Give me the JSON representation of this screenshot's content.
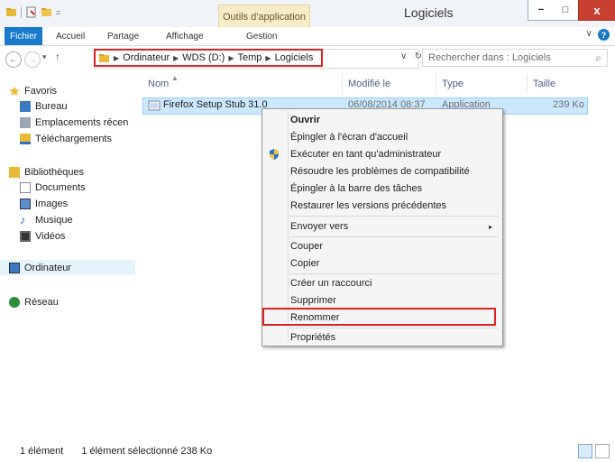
{
  "window": {
    "title": "Logiciels",
    "context_tab": "Outils d'application",
    "min_label": "−",
    "max_label": "□",
    "close_label": "x"
  },
  "ribbon": {
    "tabs": [
      "Fichier",
      "Accueil",
      "Partage",
      "Affichage",
      "Gestion"
    ],
    "chevron": "∨",
    "help": "?"
  },
  "address": {
    "back": "←",
    "forward": "→",
    "up": "↑",
    "recent": "▾",
    "crumbs": [
      "Ordinateur",
      "WDS (D:)",
      "Temp",
      "Logiciels"
    ],
    "dropdown": "∨",
    "refresh": "↻",
    "search_placeholder": "Rechercher dans : Logiciels",
    "search_icon": "⌕"
  },
  "nav": {
    "favoris": "Favoris",
    "fav_items": [
      "Bureau",
      "Emplacements récen",
      "Téléchargements"
    ],
    "bibliotheques": "Bibliothèques",
    "lib_items": [
      "Documents",
      "Images",
      "Musique",
      "Vidéos"
    ],
    "ordinateur": "Ordinateur",
    "reseau": "Réseau"
  },
  "columns": [
    "Nom",
    "Modifié le",
    "Type",
    "Taille"
  ],
  "file": {
    "name": "Firefox Setup Stub 31.0",
    "modified": "06/08/2014 08:37",
    "type": "Application",
    "size": "239 Ko"
  },
  "status": {
    "count": "1 élément",
    "selection": "1 élément sélectionné 238 Ko"
  },
  "context_menu": {
    "open": "Ouvrir",
    "pin_start": "Épingler à l'écran d'accueil",
    "run_admin": "Exécuter en tant qu'administrateur",
    "compat": "Résoudre les problèmes de compatibilité",
    "pin_taskbar": "Épingler à la barre des tâches",
    "restore": "Restaurer les versions précédentes",
    "send_to": "Envoyer vers",
    "send_arrow": "▸",
    "cut": "Couper",
    "copy": "Copier",
    "shortcut": "Créer un raccourci",
    "delete": "Supprimer",
    "rename": "Renommer",
    "properties": "Propriétés"
  },
  "colors": {
    "accent": "#1979ca",
    "highlight": "#dd2222",
    "selection": "#cce8ff"
  }
}
